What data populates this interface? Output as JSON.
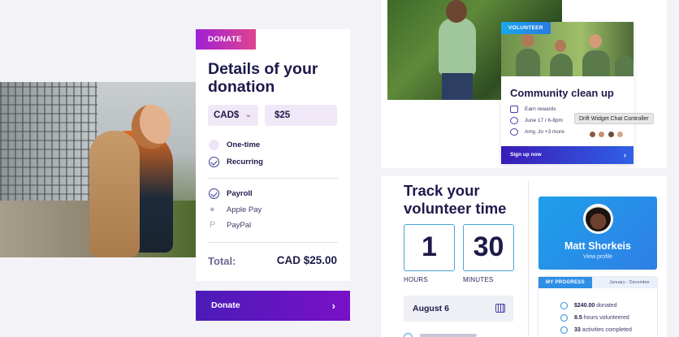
{
  "donation": {
    "tag": "DONATE",
    "title": "Details of your donation",
    "currency": "CAD$",
    "amount": "$25",
    "frequency": [
      {
        "label": "One-time",
        "selected": false
      },
      {
        "label": "Recurring",
        "selected": true
      }
    ],
    "payment_methods": [
      {
        "label": "Payroll",
        "selected": true,
        "icon": "check-circle-icon"
      },
      {
        "label": "Apple Pay",
        "selected": false,
        "icon": "apple-icon"
      },
      {
        "label": "PayPal",
        "selected": false,
        "icon": "paypal-icon"
      }
    ],
    "total_label": "Total:",
    "total_value": "CAD $25.00",
    "donate_button": "Donate"
  },
  "community": {
    "tag": "VOLUNTEER",
    "title": "Community clean up",
    "rows": [
      {
        "icon": "gift-icon",
        "text": "Earn rewards"
      },
      {
        "icon": "clock-icon",
        "text": "June 17 / 6-8pm"
      },
      {
        "icon": "people-icon",
        "text": "Amy, Jo +3 more"
      }
    ],
    "signup_button": "Sign up now",
    "tooltip": "Drift Widget Chat Controller"
  },
  "track": {
    "title": "Track your volunteer time",
    "hours_value": "1",
    "minutes_value": "30",
    "hours_label": "HOURS",
    "minutes_label": "MINUTES",
    "date": "August 6"
  },
  "profile": {
    "name": "Matt Shorkeis",
    "link": "View profile",
    "progress_tab": "MY PROGRESS",
    "progress_range": "January - December",
    "stats": [
      {
        "value": "$240.00",
        "label": "donated"
      },
      {
        "value": "8.5",
        "label": "hours volunteered"
      },
      {
        "value": "33",
        "label": "activities completed"
      }
    ]
  },
  "colors": {
    "brand_purple": "#4a1bb8",
    "brand_pink": "#e0438f",
    "brand_blue": "#2f8fe4",
    "navy_text": "#1d1a4a"
  }
}
